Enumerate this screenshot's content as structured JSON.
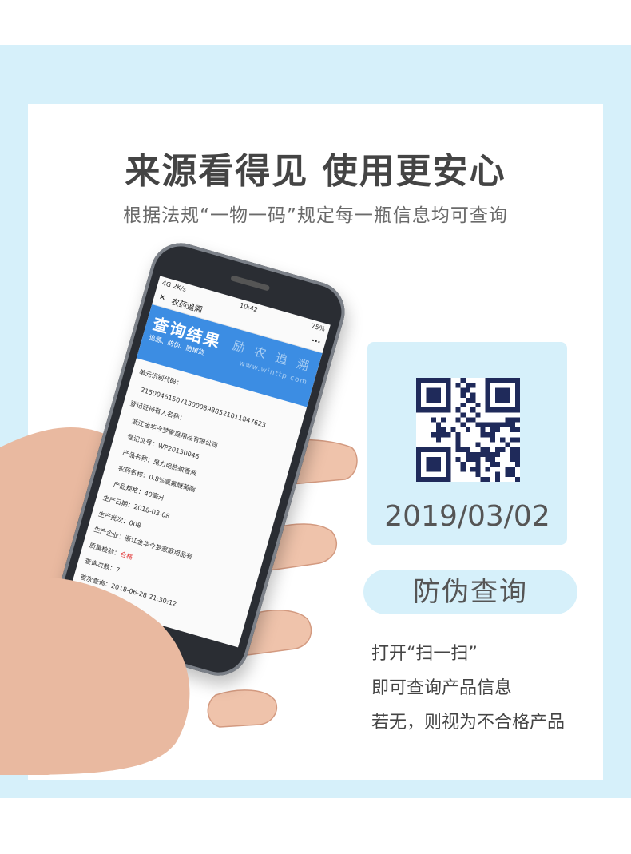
{
  "headline": "来源看得见 使用更安心",
  "subline": "根据法规“一物一码”规定每一瓶信息均可查询",
  "phone": {
    "status_left": "4G  2K/s",
    "time": "10:42",
    "status_right": "75%",
    "close_icon": "✕",
    "nav_title": "农药追溯",
    "more": "···",
    "banner_title": "查询结果",
    "banner_sub": "追源、防伪、防窜货",
    "banner_watermark": "励 农 追 溯",
    "banner_url": "www.winttp.com",
    "rows": [
      "单元识别代码：",
      "215004615071300089885210118476​23",
      "登记证持有人名称：",
      "浙江金华今梦家庭用品有限公司",
      "登记证号：WP20150046",
      "产品名称：鬼力电热蚊香液",
      "农药名称：0.8%氯氟醚菊酯",
      "产品规格：40毫升",
      "生产日期：2018-03-08",
      "生产批次：008",
      "生产企业：浙江金华今梦家庭用品有",
      "质量检验：",
      "查询次数：7",
      "首次查询：2018-06-28 21:30:12"
    ],
    "quality_value": "合格"
  },
  "qr": {
    "icon": "qr-code-icon",
    "date": "2019/03/02"
  },
  "cta_button": "防伪查询",
  "instructions": [
    "打开“扫一扫”",
    "即可查询产品信息",
    "若无，则视为不合格产品"
  ],
  "colors": {
    "band": "#d6f0fa",
    "banner": "#3c8de3",
    "qr_dark": "#1f2a5a"
  }
}
